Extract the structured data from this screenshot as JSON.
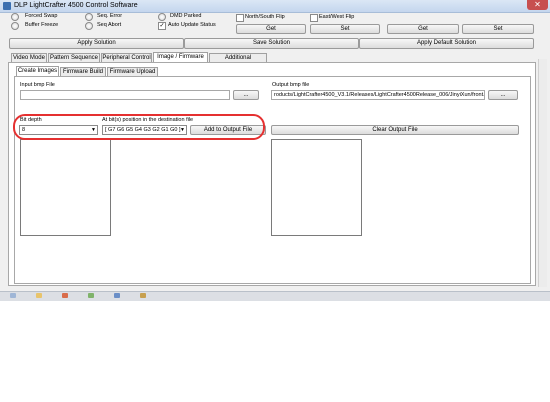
{
  "window": {
    "title": "DLP LightCrafter 4500 Control Software",
    "close": "✕"
  },
  "options": {
    "forced_swap": "Forced Swap",
    "buffer_freeze": "Buffer Freeze",
    "seq_error": "Seq. Error",
    "seq_abort": "Seq Abort",
    "dmd_parked": "DMD Parked",
    "auto_update": "Auto Update Status",
    "auto_update_checked": "✓",
    "north_south": "North/South Flip",
    "east_west": "East/West Flip"
  },
  "buttons": {
    "get1": "Get",
    "set1": "Set",
    "get2": "Get",
    "set2": "Set",
    "apply_solution": "Apply Solution",
    "save_solution": "Save Solution",
    "apply_default": "Apply Default Solution",
    "browse_input": "...",
    "browse_output": "...",
    "add_to_output": "Add to Output File",
    "clear_output": "Clear Output File"
  },
  "tabs": [
    "Video Mode",
    "Pattern Sequence",
    "Peripheral Control",
    "Image / Firmware",
    "Additional Resources"
  ],
  "subtabs": [
    "Create Images",
    "Firmware Build",
    "Firmware Upload"
  ],
  "create_images": {
    "input_label": "Input bmp File",
    "input_value": "",
    "output_label": "Output bmp file",
    "output_value": "roducts/LightCrafter4500_V3.1/Releases/LightCrafter4500Release_006/JinyiXun/front.bmp",
    "bit_depth_label": "Bit depth",
    "bit_depth_value": "8",
    "bit_position_label": "At bit(s) position in the destination file",
    "bit_position_value": "[ G7 G6 G5 G4 G3 G2 G1 G0 ]"
  }
}
